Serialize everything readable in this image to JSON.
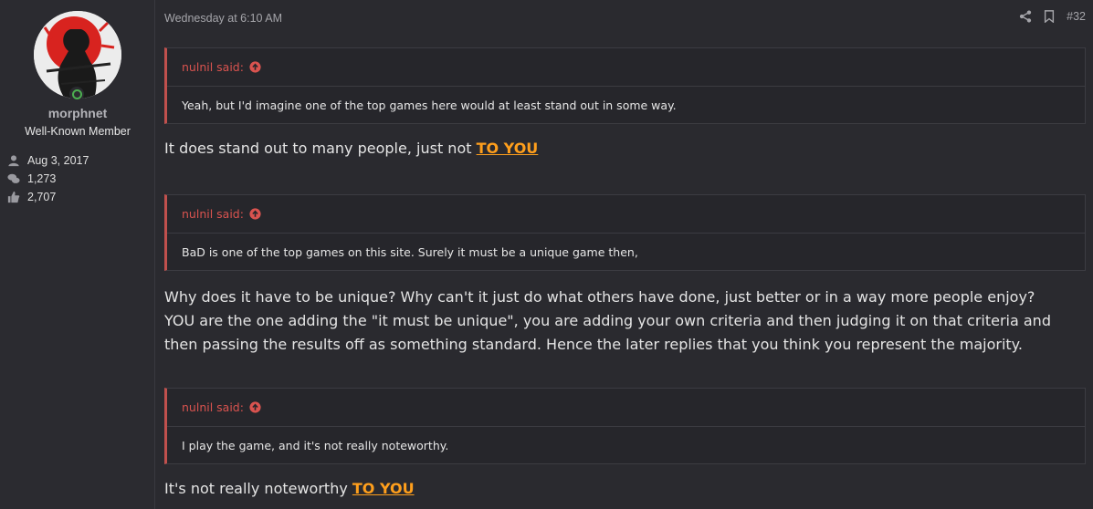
{
  "user": {
    "name": "morphnet",
    "title": "Well-Known Member",
    "joined": "Aug 3, 2017",
    "messages": "1,273",
    "reactions": "2,707"
  },
  "post": {
    "date": "Wednesday at 6:10 AM",
    "number": "#32",
    "quotes": [
      {
        "author": "nulnil said:",
        "text": "Yeah, but I'd imagine one of the top games here would at least stand out in some way."
      },
      {
        "author": "nulnil said:",
        "text": "BaD is one of the top games on this site. Surely it must be a unique game then,"
      },
      {
        "author": "nulnil said:",
        "text": "I play the game, and it's not really noteworthy."
      }
    ],
    "reply1": {
      "text": "It does stand out to many people, just not ",
      "emphasis": "TO YOU"
    },
    "reply2": {
      "line1": "Why does it have to be unique? Why can't it just do what others have done, just better or in a way more people enjoy?",
      "line2": "YOU are the one adding the \"it must be unique\", you are adding your own criteria and then judging it on that criteria and",
      "line3": "then passing the results off as something standard. Hence the later replies that you think you represent the majority."
    },
    "reply3": {
      "text": "It's not really noteworthy ",
      "emphasis": "TO YOU"
    }
  },
  "icons": {
    "online": "online-indicator-icon",
    "calendar": "user-icon",
    "messages": "comments-icon",
    "reactions": "thumbs-up-icon",
    "share": "share-icon",
    "bookmark": "bookmark-icon",
    "quote_arrow": "arrow-up-circle-icon"
  },
  "colors": {
    "quote_accent": "#d9534f",
    "emphasis": "#ff9f1c"
  }
}
